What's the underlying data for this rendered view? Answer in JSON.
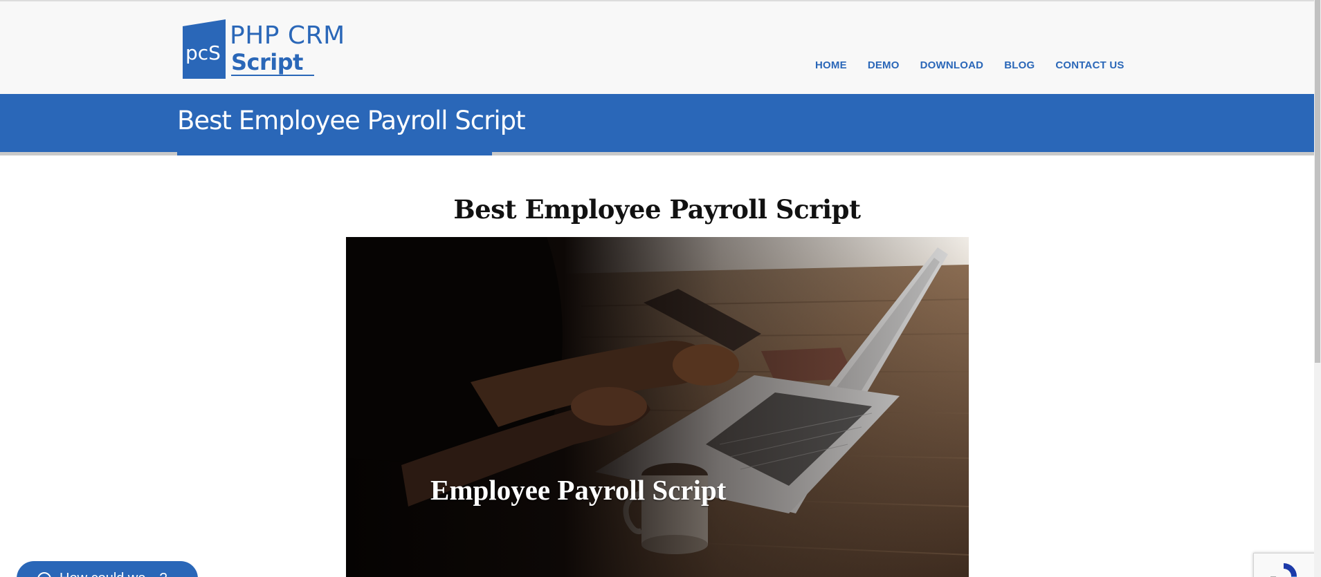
{
  "logo": {
    "mark": "pcS",
    "line1": "PHP CRM",
    "line2": "Script"
  },
  "nav": {
    "items": [
      {
        "label": "HOME"
      },
      {
        "label": "DEMO"
      },
      {
        "label": "DOWNLOAD"
      },
      {
        "label": "BLOG"
      },
      {
        "label": "CONTACT US"
      }
    ]
  },
  "banner": {
    "title": "Best Employee Payroll Script"
  },
  "content": {
    "heading": "Best Employee Payroll Script",
    "image_caption": "Employee Payroll Script"
  },
  "chat": {
    "label": "How could we…?"
  },
  "colors": {
    "brand": "#2a67b8",
    "banner_bottom": "#c9c9c9",
    "header_bg": "#f8f8f8"
  },
  "icons": {
    "chat": "chat-bubble-icon",
    "recaptcha": "recaptcha-icon"
  }
}
